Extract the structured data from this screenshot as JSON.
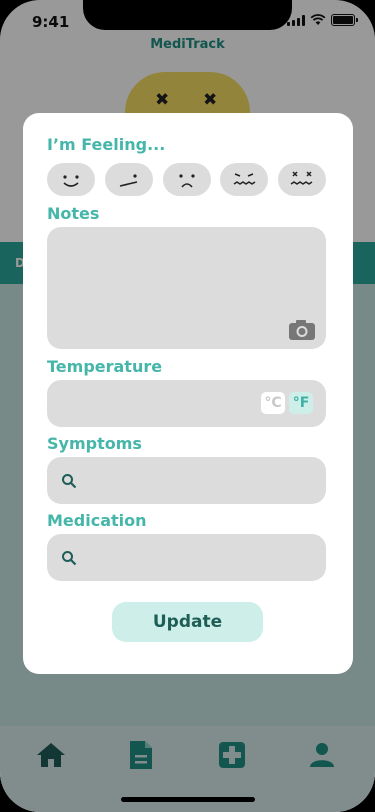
{
  "status_bar": {
    "time": "9:41"
  },
  "app": {
    "title": "MediTrack",
    "band_label": "D"
  },
  "modal": {
    "feeling_label": "I’m Feeling...",
    "faces": [
      "smile-face-icon",
      "meh-face-icon",
      "sad-face-icon",
      "sick-face-icon",
      "very-sick-face-icon"
    ],
    "notes_label": "Notes",
    "notes_value": "",
    "temperature_label": "Temperature",
    "temperature_value": "",
    "unit_c": "°C",
    "unit_f": "°F",
    "selected_unit": "°F",
    "symptoms_label": "Symptoms",
    "symptoms_value": "",
    "medication_label": "Medication",
    "medication_value": "",
    "update_label": "Update"
  },
  "tab_bar": [
    "home-icon",
    "document-icon",
    "medical-cross-icon",
    "profile-icon"
  ],
  "colors": {
    "accent": "#45b6a9",
    "accent_light": "#cdeee9",
    "field_bg": "#dcdcdc"
  }
}
